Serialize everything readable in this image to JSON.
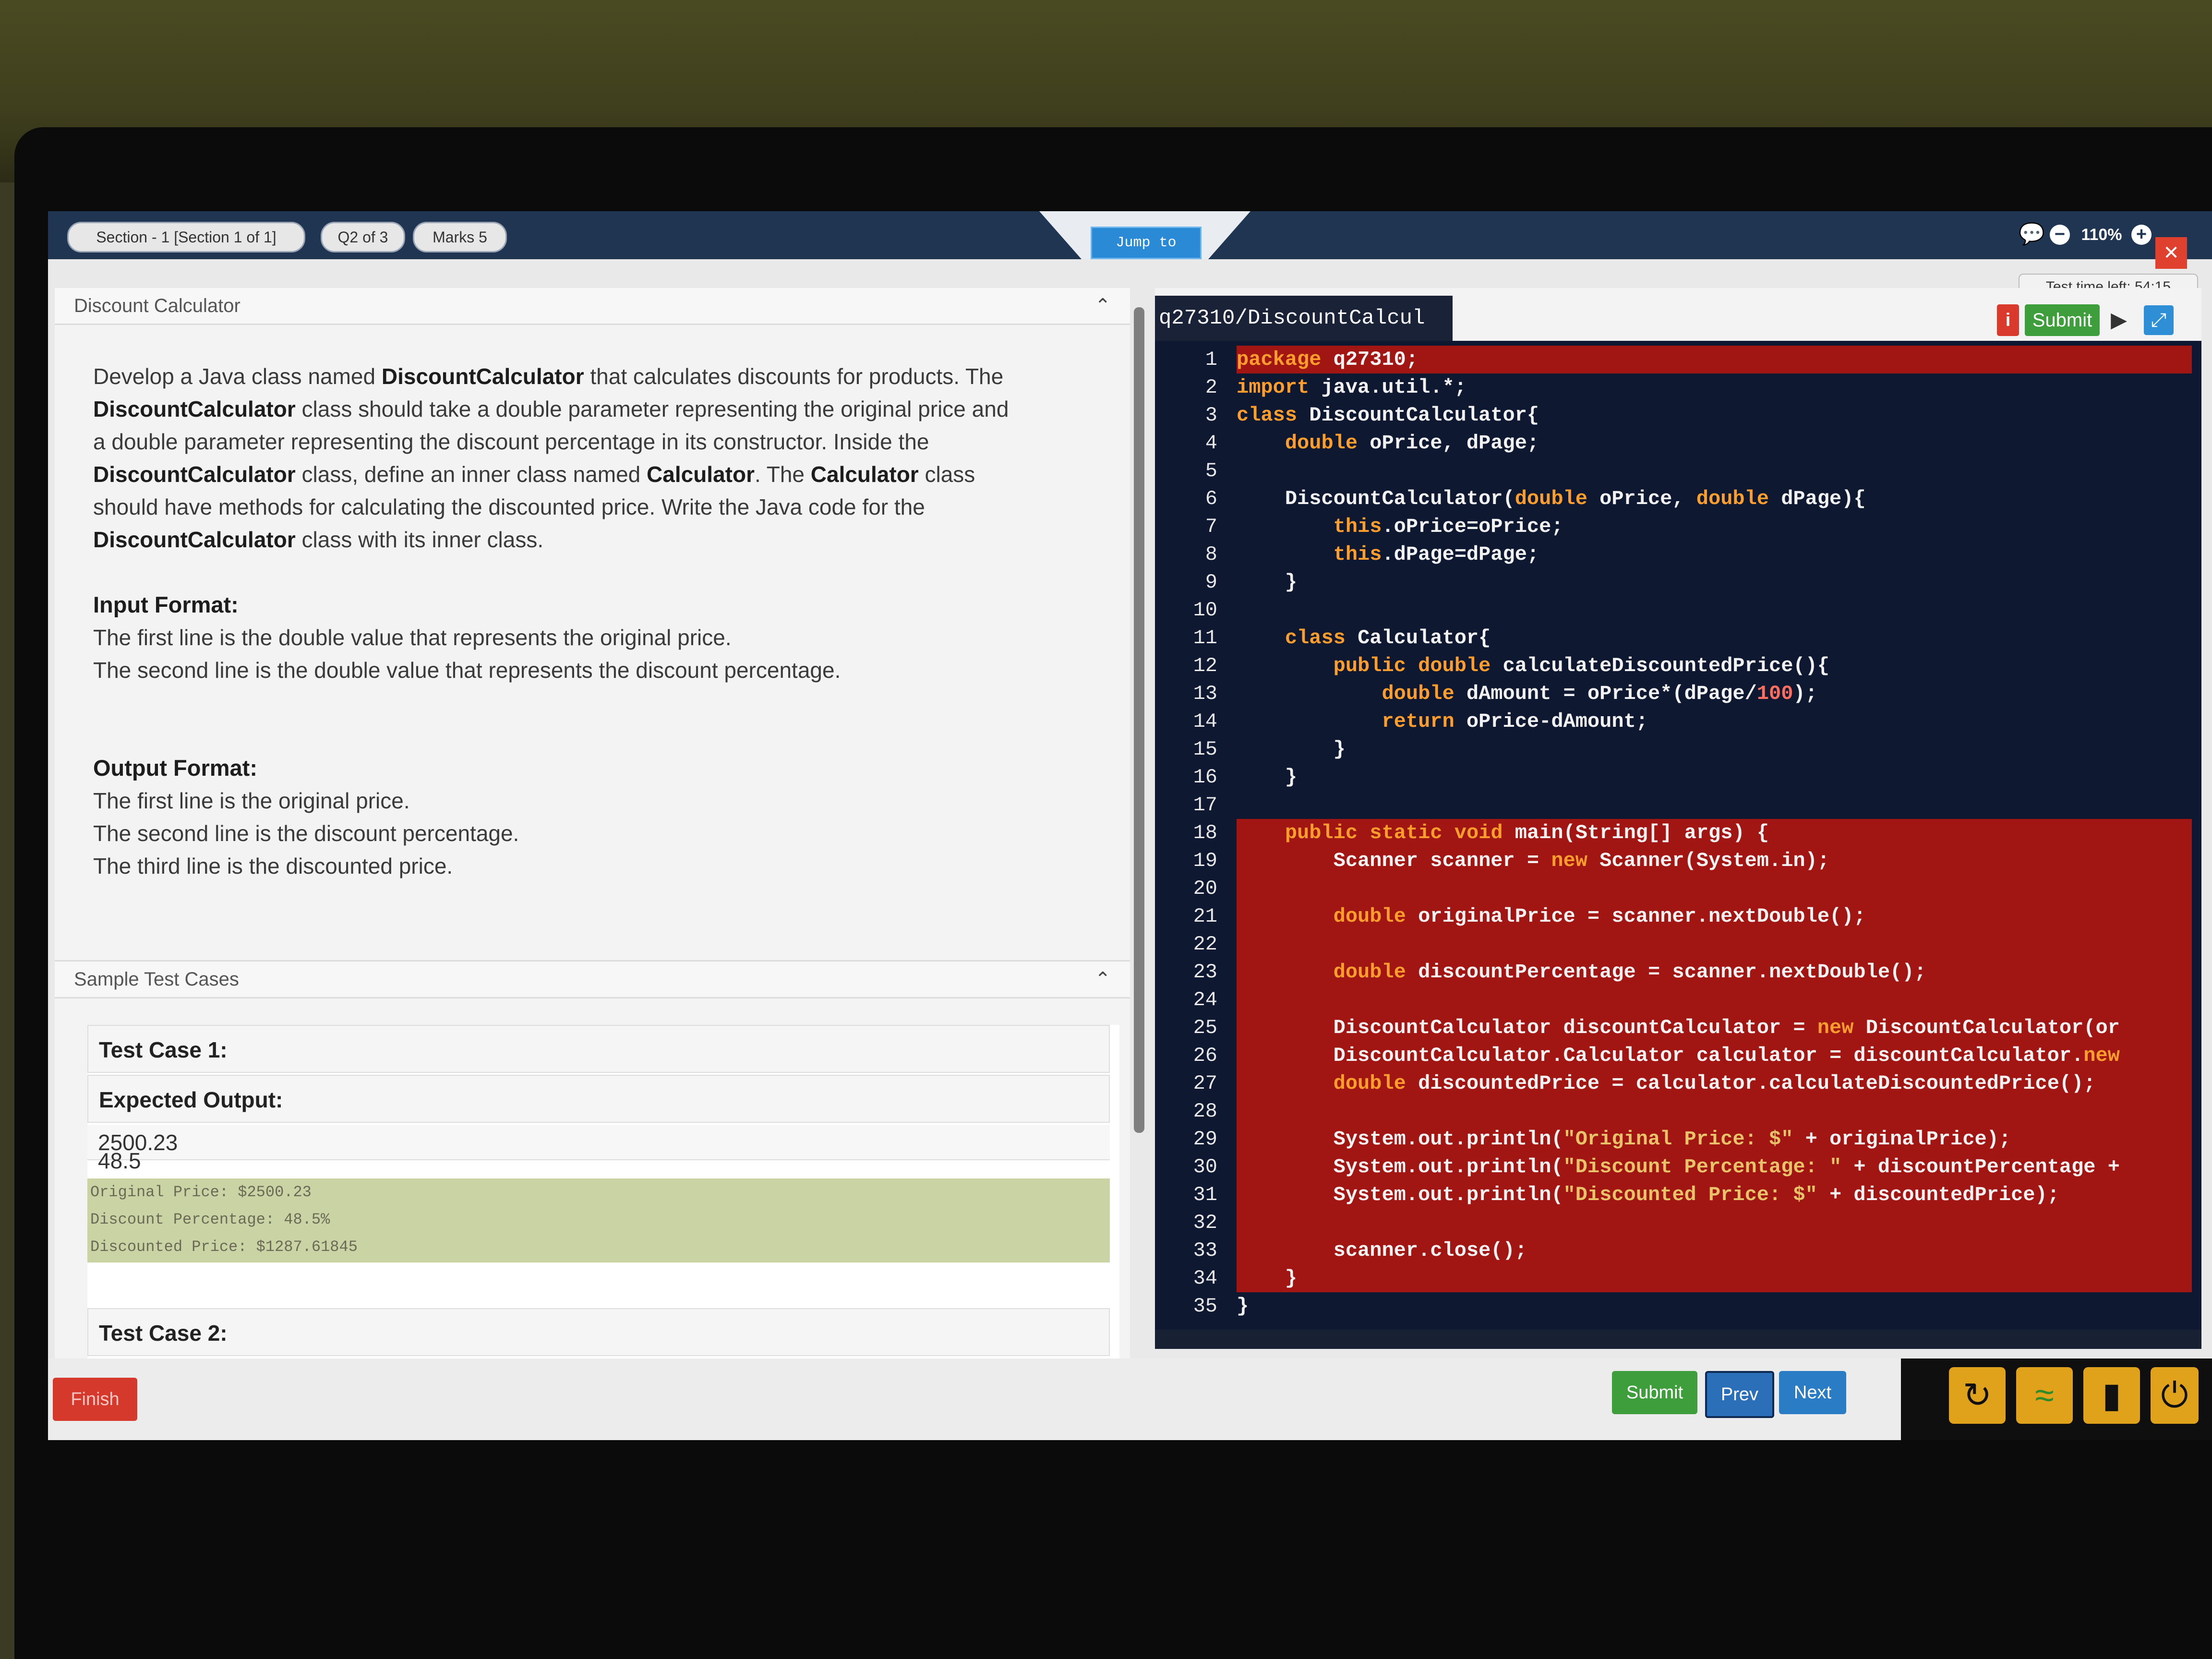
{
  "header": {
    "section_pill": "Section - 1 [Section 1 of 1]",
    "question_pill": "Q2 of 3",
    "marks_pill": "Marks 5",
    "jump_label": "Jump to",
    "zoom_level": "110%",
    "time_left": "Test time left: 54:15"
  },
  "question": {
    "title": "Discount Calculator",
    "description": [
      [
        "Develop a Java class named ",
        "DiscountCalculator",
        " that calculates discounts for products. The"
      ],
      [
        "",
        "DiscountCalculator",
        " class should take a double parameter representing the original price and"
      ],
      [
        "a double parameter representing the discount percentage in its constructor. Inside the",
        "",
        ""
      ],
      [
        "",
        "DiscountCalculator",
        " class, define an inner class named "
      ],
      [
        "should have methods for calculating the discounted price. Write the Java code for the",
        "",
        ""
      ],
      [
        "",
        "DiscountCalculator",
        " class with its inner class."
      ]
    ],
    "desc_line4_b2": "Calculator",
    "desc_line4_mid": ". The ",
    "desc_line4_b3": "Calculator",
    "desc_line4_end": " class",
    "input_title": "Input Format:",
    "input_lines": [
      "The first line is the double value that represents the original price.",
      "The second line is the double value that represents the discount percentage."
    ],
    "output_title": "Output Format:",
    "output_lines": [
      "The first line is the original price.",
      "The second line is the discount percentage.",
      "The third line is the discounted price."
    ]
  },
  "sample_tests": {
    "title": "Sample Test Cases",
    "test_case_1": "Test Case 1:",
    "expected_output_label": "Expected Output:",
    "inputs": [
      "2500.23",
      "48.5"
    ],
    "output_lines": [
      "Original Price: $2500.23",
      "Discount Percentage: 48.5%",
      "Discounted Price: $1287.61845"
    ],
    "test_case_2": "Test Case 2:"
  },
  "editor": {
    "file_tab": "q27310/DiscountCalcul",
    "submit_label": "Submit",
    "info_label": "i",
    "highlight_lines": [
      1,
      18,
      19,
      20,
      21,
      22,
      23,
      24,
      25,
      26,
      27,
      28,
      29,
      30,
      31,
      32,
      33,
      34
    ],
    "lines": [
      "package q27310;",
      "import java.util.*;",
      "class DiscountCalculator{",
      "    double oPrice, dPage;",
      "",
      "    DiscountCalculator(double oPrice, double dPage){",
      "        this.oPrice=oPrice;",
      "        this.dPage=dPage;",
      "    }",
      "",
      "    class Calculator{",
      "        public double calculateDiscountedPrice(){",
      "            double dAmount = oPrice*(dPage/100);",
      "            return oPrice-dAmount;",
      "        }",
      "    }",
      "",
      "    public static void main(String[] args) {",
      "        Scanner scanner = new Scanner(System.in);",
      "",
      "        double originalPrice = scanner.nextDouble();",
      "",
      "        double discountPercentage = scanner.nextDouble();",
      "",
      "        DiscountCalculator discountCalculator = new DiscountCalculator(or",
      "        DiscountCalculator.Calculator calculator = discountCalculator.new",
      "        double discountedPrice = calculator.calculateDiscountedPrice();",
      "",
      "        System.out.println(\"Original Price: $\" + originalPrice);",
      "        System.out.println(\"Discount Percentage: \" + discountPercentage +",
      "        System.out.println(\"Discounted Price: $\" + discountedPrice);",
      "",
      "        scanner.close();",
      "    }",
      "}"
    ]
  },
  "footer": {
    "finish_label": "Finish",
    "submit_label": "Submit",
    "prev_label": "Prev",
    "next_label": "Next"
  },
  "colors": {
    "topbar": "#1f3552",
    "highlight": "#a11513",
    "keyword": "#ff9e2c",
    "submit_green": "#3e9e3c",
    "nav_blue": "#2a7cc4",
    "finish_red": "#d5392c",
    "tray_icon": "#e0a21a"
  }
}
